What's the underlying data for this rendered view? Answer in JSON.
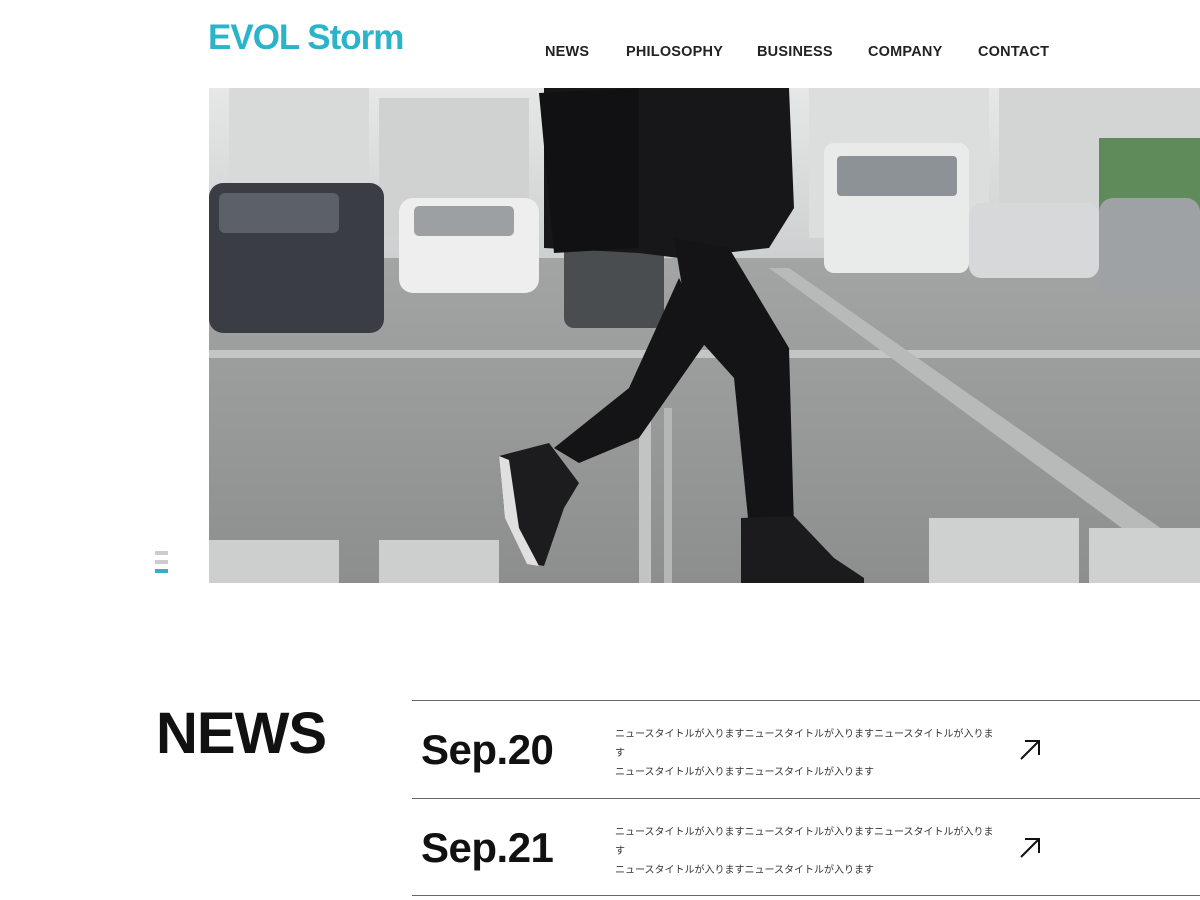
{
  "brand": {
    "name_part1": "EVOL",
    "name_part2": "Storm",
    "color": "#2bb3c9"
  },
  "nav": {
    "items": [
      {
        "label": "NEWS"
      },
      {
        "label": "PHILOSOPHY"
      },
      {
        "label": "BUSINESS"
      },
      {
        "label": "COMPANY"
      },
      {
        "label": "CONTACT"
      }
    ]
  },
  "hero": {
    "image_icon": "street-runner-photo"
  },
  "slider": {
    "slide_count": 3,
    "active_index": 2,
    "inactive_color": "#cccccc",
    "active_color": "#2bb3c9"
  },
  "news": {
    "heading": "NEWS",
    "items": [
      {
        "date": "Sep.20",
        "line1": "ニュースタイトルが入りますニュースタイトルが入りますニュースタイトルが入ります",
        "line2": "ニュースタイトルが入りますニュースタイトルが入ります",
        "icon": "arrow-up-right-icon"
      },
      {
        "date": "Sep.21",
        "line1": "ニュースタイトルが入りますニュースタイトルが入りますニュースタイトルが入ります",
        "line2": "ニュースタイトルが入りますニュースタイトルが入ります",
        "icon": "arrow-up-right-icon"
      }
    ]
  }
}
